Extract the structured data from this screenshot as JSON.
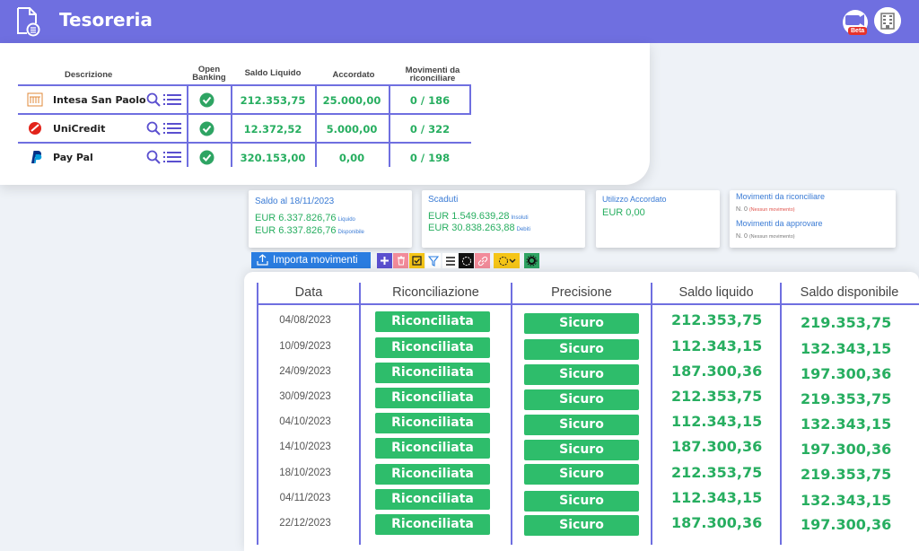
{
  "app": {
    "title": "Tesoreria",
    "beta_badge": "Beta"
  },
  "banks": {
    "headers": {
      "descrizione": "Descrizione",
      "open_banking_1": "Open",
      "open_banking_2": "Banking",
      "saldo_liquido": "Saldo Liquido",
      "accordato": "Accordato",
      "movimenti_1": "Movimenti da",
      "movimenti_2": "riconciliare"
    },
    "rows": [
      {
        "name": "Intesa San Paolo",
        "logo": "intesa-logo",
        "saldo": "212.353,75",
        "accordato": "25.000,00",
        "movimenti": "0 / 186"
      },
      {
        "name": "UniCredit",
        "logo": "unicredit-logo",
        "saldo": "12.372,52",
        "accordato": "5.000,00",
        "movimenti": "0 / 322"
      },
      {
        "name": "Pay Pal",
        "logo": "paypal-logo",
        "saldo": "320.153,00",
        "accordato": "0,00",
        "movimenti": "0 / 198"
      }
    ]
  },
  "summary": {
    "saldo": {
      "title": "Saldo al 18/11/2023",
      "liquido_value": "EUR 6.337.826,76",
      "liquido_label": "Liquido",
      "disponibile_value": "EUR 6.337.826,76",
      "disponibile_label": "Disponibile"
    },
    "scaduti": {
      "title": "Scaduti",
      "insoluti_value": "EUR 1.549.639,28",
      "insoluti_label": "Insoluti",
      "debiti_value": "EUR 30.838.263,88",
      "debiti_label": "Debiti"
    },
    "accordato": {
      "title": "Utilizzo Accordato",
      "value": "EUR 0,00"
    },
    "movimenti": {
      "riconciliare_title": "Movimenti da riconciliare",
      "riconciliare_count": "N. 0",
      "riconciliare_note": "(Nessun movimento)",
      "approvare_title": "Movimenti da approvare",
      "approvare_count": "N. 0",
      "approvare_note": "(Nessun movimento)"
    }
  },
  "toolbar": {
    "import_label": "Importa movimenti"
  },
  "movements": {
    "headers": {
      "data": "Data",
      "riconciliazione": "Riconciliazione",
      "precisione": "Precisione",
      "saldo_liquido": "Saldo liquido",
      "saldo_disponibile": "Saldo disponibile"
    },
    "rows": [
      {
        "date": "04/08/2023",
        "riconciliazione": "Riconciliata",
        "precisione": "Sicuro",
        "liquido": "212.353,75",
        "disponibile": "219.353,75"
      },
      {
        "date": "10/09/2023",
        "riconciliazione": "Riconciliata",
        "precisione": "Sicuro",
        "liquido": "112.343,15",
        "disponibile": "132.343,15"
      },
      {
        "date": "24/09/2023",
        "riconciliazione": "Riconciliata",
        "precisione": "Sicuro",
        "liquido": "187.300,36",
        "disponibile": "197.300,36"
      },
      {
        "date": "30/09/2023",
        "riconciliazione": "Riconciliata",
        "precisione": "Sicuro",
        "liquido": "212.353,75",
        "disponibile": "219.353,75"
      },
      {
        "date": "04/10/2023",
        "riconciliazione": "Riconciliata",
        "precisione": "Sicuro",
        "liquido": "112.343,15",
        "disponibile": "132.343,15"
      },
      {
        "date": "14/10/2023",
        "riconciliazione": "Riconciliata",
        "precisione": "Sicuro",
        "liquido": "187.300,36",
        "disponibile": "197.300,36"
      },
      {
        "date": "18/10/2023",
        "riconciliazione": "Riconciliata",
        "precisione": "Sicuro",
        "liquido": "212.353,75",
        "disponibile": "219.353,75"
      },
      {
        "date": "04/11/2023",
        "riconciliazione": "Riconciliata",
        "precisione": "Sicuro",
        "liquido": "112.343,15",
        "disponibile": "132.343,15"
      },
      {
        "date": "22/12/2023",
        "riconciliazione": "Riconciliata",
        "precisione": "Sicuro",
        "liquido": "187.300,36",
        "disponibile": "197.300,36"
      }
    ]
  },
  "colors": {
    "header_bar": "#6f6fe0",
    "value_green": "#27ae60",
    "pill_green": "#2ebd6b",
    "link_blue": "#3a7bd5"
  }
}
